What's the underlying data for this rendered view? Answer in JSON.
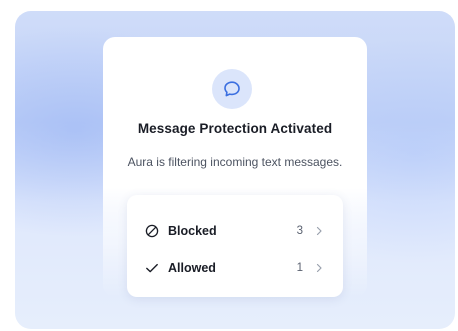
{
  "dialog": {
    "icon": "chat-bubble-icon",
    "title": "Message Protection Activated",
    "subtitle": "Aura is filtering incoming text messages."
  },
  "filters": [
    {
      "icon": "blocked-icon",
      "label": "Blocked",
      "count": "3"
    },
    {
      "icon": "check-icon",
      "label": "Allowed",
      "count": "1"
    }
  ],
  "colors": {
    "accent": "#3b6fe0",
    "icon_bg": "#dbe5fb",
    "backdrop": "#c8d7f8",
    "text_primary": "#1a1d26",
    "text_secondary": "#4c5361"
  }
}
